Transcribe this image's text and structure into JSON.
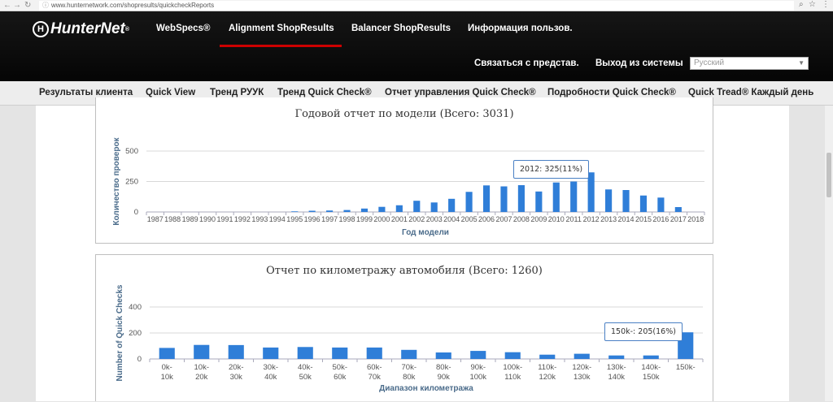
{
  "browser": {
    "url": "www.hunternetwork.com/shopresults/quickcheckReports"
  },
  "header": {
    "logo": "HunterNet",
    "nav": [
      "WebSpecs®",
      "Alignment ShopResults",
      "Balancer ShopResults",
      "Информация пользов."
    ],
    "contact": "Связаться с представ.",
    "logout": "Выход из системы",
    "language": "Русский"
  },
  "tabs": [
    "Результаты клиента",
    "Quick View",
    "Тренд РУУК",
    "Тренд Quick Check®",
    "Отчет управления Quick Check®",
    "Подробности Quick Check®",
    "Quick Tread® Каждый день"
  ],
  "colors": {
    "bar": "#2f7ed8",
    "accent": "#cc0000",
    "axis_label": "#4a6b8a"
  },
  "chart_data": [
    {
      "type": "bar",
      "title": "Годовой отчет по модели (Всего: 3031)",
      "xlabel": "Год модели",
      "ylabel": "Количество проверок",
      "ylim": [
        0,
        500
      ],
      "yticks": [
        "0",
        "250",
        "500"
      ],
      "categories": [
        "1987",
        "1988",
        "1989",
        "1990",
        "1991",
        "1992",
        "1993",
        "1994",
        "1995",
        "1996",
        "1997",
        "1998",
        "1999",
        "2000",
        "2001",
        "2002",
        "2003",
        "2004",
        "2005",
        "2006",
        "2007",
        "2008",
        "2009",
        "2010",
        "2011",
        "2012",
        "2013",
        "2014",
        "2015",
        "2016",
        "2017",
        "2018"
      ],
      "values": [
        0,
        0,
        0,
        0,
        0,
        0,
        0,
        0,
        5,
        10,
        12,
        16,
        28,
        42,
        55,
        92,
        78,
        108,
        165,
        218,
        210,
        220,
        168,
        242,
        250,
        325,
        185,
        180,
        135,
        118,
        40,
        0
      ],
      "tooltip": "2012: 325(11%)"
    },
    {
      "type": "bar",
      "title": "Отчет по километражу автомобиля (Всего: 1260)",
      "xlabel": "Диапазон километража",
      "ylabel": "Number of Quick Checks",
      "ylim": [
        0,
        400
      ],
      "yticks": [
        "0",
        "200",
        "400"
      ],
      "categories": [
        "0k-10k",
        "10k-20k",
        "20k-30k",
        "30k-40k",
        "40k-50k",
        "50k-60k",
        "60k-70k",
        "70k-80k",
        "80k-90k",
        "90k-100k",
        "100k-110k",
        "110k-120k",
        "120k-130k",
        "130k-140k",
        "140k-150k",
        "150k-"
      ],
      "values": [
        85,
        108,
        107,
        88,
        92,
        88,
        88,
        70,
        50,
        62,
        52,
        33,
        40,
        27,
        27,
        205
      ],
      "tooltip": "150k-: 205(16%)"
    }
  ]
}
